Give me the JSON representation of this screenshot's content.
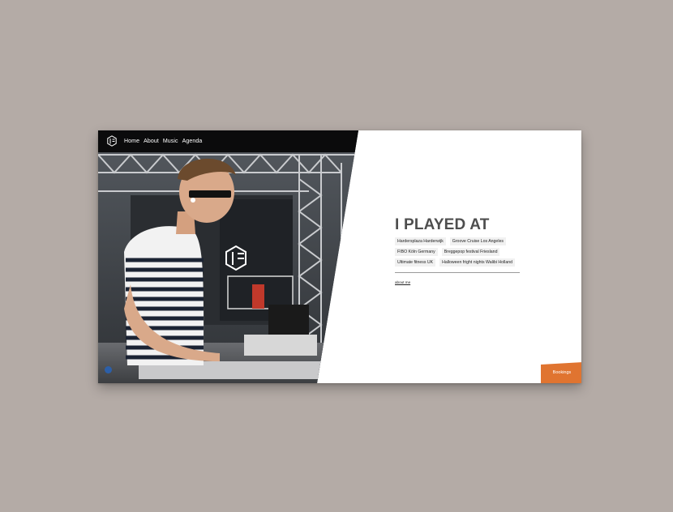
{
  "nav": {
    "items": [
      {
        "label": "Home"
      },
      {
        "label": "About"
      },
      {
        "label": "Music"
      },
      {
        "label": "Agenda"
      }
    ]
  },
  "hero": {
    "image_subject": "DJ in striped shirt at a stage deck under truss lighting rig"
  },
  "section": {
    "title": "I PLAYED AT",
    "venues": [
      "Hardersplaza Harderwijk",
      "Groove Cruise Los Angeles",
      "FIBO Köln Germany",
      "Breggepop festival Friesland",
      "Ultimate fitness UK",
      "Halloween fright nights Walibi Holland"
    ],
    "link_label": "about me"
  },
  "cta": {
    "bookings_label": "Bookings"
  },
  "colors": {
    "page_background": "#b4aba6",
    "panel_background": "#ffffff",
    "accent": "#e07430",
    "title": "#4e4e4e"
  }
}
